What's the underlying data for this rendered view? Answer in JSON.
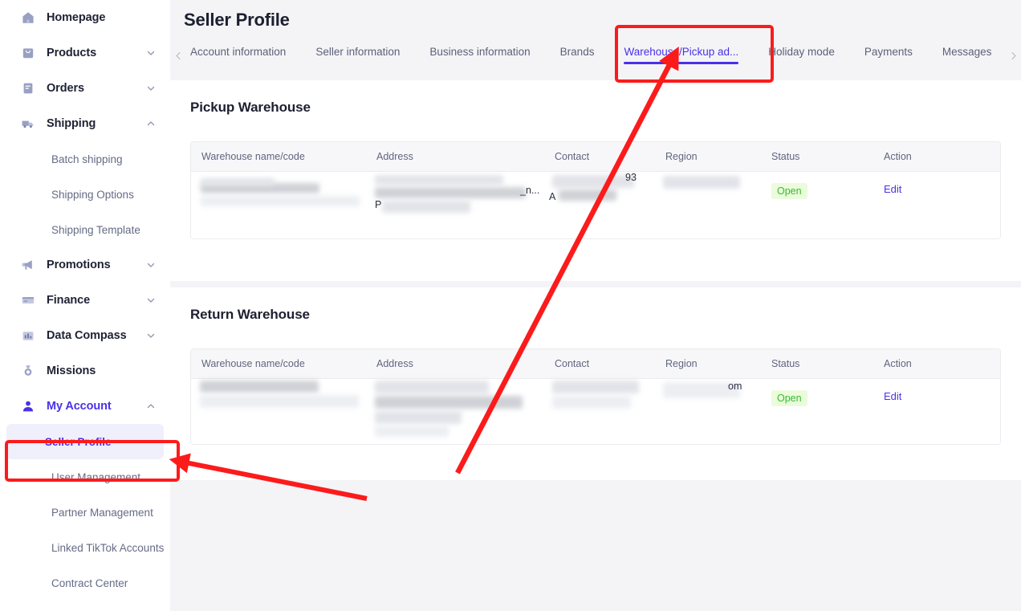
{
  "sidebar": {
    "items": [
      {
        "label": "Homepage",
        "icon": "home-icon",
        "expandable": false,
        "state": "none",
        "active": false
      },
      {
        "label": "Products",
        "icon": "shopping-bag-icon",
        "expandable": true,
        "state": "collapsed",
        "active": false
      },
      {
        "label": "Orders",
        "icon": "clipboard-icon",
        "expandable": true,
        "state": "collapsed",
        "active": false
      },
      {
        "label": "Shipping",
        "icon": "truck-icon",
        "expandable": true,
        "state": "expanded",
        "active": false
      },
      {
        "label": "Promotions",
        "icon": "megaphone-icon",
        "expandable": true,
        "state": "collapsed",
        "active": false
      },
      {
        "label": "Finance",
        "icon": "credit-card-icon",
        "expandable": true,
        "state": "collapsed",
        "active": false
      },
      {
        "label": "Data Compass",
        "icon": "bar-chart-icon",
        "expandable": true,
        "state": "collapsed",
        "active": false
      },
      {
        "label": "Missions",
        "icon": "medal-icon",
        "expandable": false,
        "state": "none",
        "active": false
      },
      {
        "label": "My Account",
        "icon": "user-icon",
        "expandable": true,
        "state": "expanded",
        "active": true
      }
    ],
    "shipping_children": [
      "Batch shipping",
      "Shipping Options",
      "Shipping Template"
    ],
    "account_children": [
      "Seller Profile",
      "User Management",
      "Partner Management",
      "Linked TikTok Accounts",
      "Contract Center"
    ],
    "selected_child": "Seller Profile"
  },
  "header": {
    "title": "Seller Profile"
  },
  "tabs": {
    "prev_icon": "chevron-left-icon",
    "next_icon": "chevron-right-icon",
    "items": [
      {
        "label": "Account information",
        "active": false
      },
      {
        "label": "Seller information",
        "active": false
      },
      {
        "label": "Business information",
        "active": false
      },
      {
        "label": "Brands",
        "active": false
      },
      {
        "label": "Warehouse/Pickup ad...",
        "active": true
      },
      {
        "label": "Holiday mode",
        "active": false
      },
      {
        "label": "Payments",
        "active": false
      },
      {
        "label": "Messages",
        "active": false
      }
    ]
  },
  "columns": [
    "Warehouse name/code",
    "Address",
    "Contact",
    "Region",
    "Status",
    "Action"
  ],
  "pickup_warehouse": {
    "title": "Pickup Warehouse",
    "rows": [
      {
        "name_code": "",
        "address": "",
        "address_fragment_1": "P",
        "address_fragment_2": "_n...",
        "contact": "",
        "contact_fragment_1": "A",
        "contact_fragment_2": "93",
        "region": "",
        "status": "Open",
        "action": "Edit"
      }
    ]
  },
  "return_warehouse": {
    "title": "Return Warehouse",
    "rows": [
      {
        "name_code": "",
        "address": "",
        "contact": "",
        "region": "",
        "region_fragment_1": "om",
        "status": "Open",
        "action": "Edit"
      }
    ]
  },
  "colors": {
    "accent": "#4a31e8",
    "status_open_text": "#2fbf2f",
    "status_open_bg": "#ecfbdc",
    "annotation_red": "#fc1b1b",
    "page_bg": "#f4f4f7",
    "card_bg": "#ffffff",
    "table_header_bg": "#f7f7fa"
  },
  "annotations": {
    "highlight_tab_box": "Warehouse/Pickup ad...",
    "highlight_sidebar_box": "Seller Profile",
    "arrow_count": 2
  }
}
